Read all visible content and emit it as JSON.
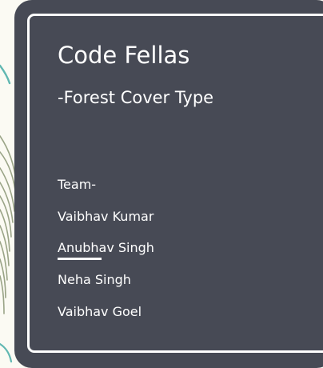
{
  "slide": {
    "title": "Code Fellas",
    "subtitle": "-Forest Cover Type",
    "team_heading": "Team-",
    "members": [
      "Vaibhav Kumar",
      "Anubhav Singh",
      "Neha Singh",
      "Vaibhav Goel"
    ]
  },
  "colors": {
    "card_background": "#474a55",
    "page_background": "#fbfaf3",
    "text": "#ffffff",
    "decor_lines": "#9aa487"
  }
}
